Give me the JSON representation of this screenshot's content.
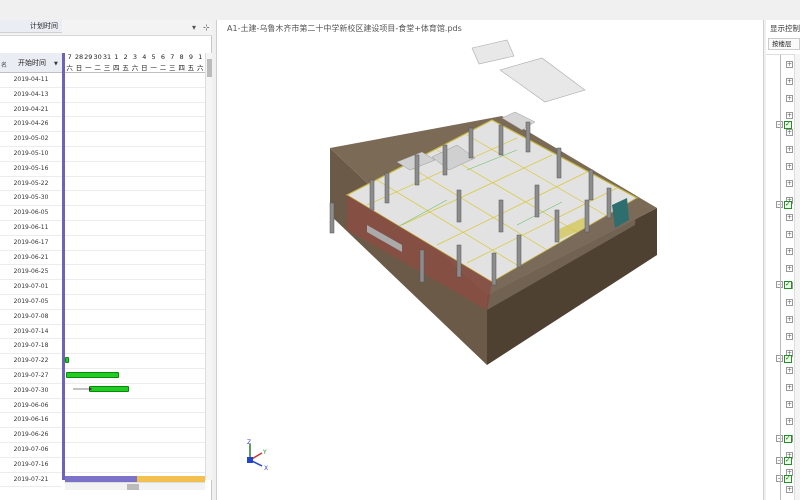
{
  "left_pane": {
    "controls": [
      "▾",
      "⊹"
    ],
    "header_top": "计划时间",
    "header_sub": "开始时间",
    "header_left_label": "名",
    "dates": [
      "2019-04-11",
      "2019-04-13",
      "2019-04-21",
      "2019-04-26",
      "2019-05-02",
      "2019-05-10",
      "2019-05-16",
      "2019-05-22",
      "2019-05-30",
      "2019-06-05",
      "2019-06-11",
      "2019-06-17",
      "2019-06-21",
      "2019-06-25",
      "2019-07-01",
      "2019-07-05",
      "2019-07-08",
      "2019-07-14",
      "2019-07-18",
      "2019-07-22",
      "2019-07-27",
      "2019-07-30",
      "2019-06-06",
      "2019-06-16",
      "2019-06-26",
      "2019-07-06",
      "2019-07-16",
      "2019-07-21"
    ],
    "gantt_days": [
      "7",
      "28",
      "29",
      "30",
      "31",
      "1",
      "2",
      "3",
      "4",
      "5",
      "6",
      "7",
      "8",
      "9",
      "1"
    ],
    "gantt_weekdays": [
      "六",
      "日",
      "一",
      "二",
      "三",
      "四",
      "五",
      "六",
      "日",
      "一",
      "二",
      "三",
      "四",
      "五",
      "六"
    ]
  },
  "viewport": {
    "title": "A1-土建-乌鲁木齐市第二十中学新校区建设项目-食堂+体育馆.pds",
    "axis": {
      "x": "X",
      "y": "Y",
      "z": "Z"
    }
  },
  "right_pane": {
    "title": "显示控制",
    "select": "按楼层"
  },
  "colors": {
    "gantt_bar": "#22cc22",
    "splitter": "#6d63b8",
    "progress_a": "#7c72c8",
    "progress_b": "#f2c04e",
    "building_wall": "#5a4a3a"
  }
}
